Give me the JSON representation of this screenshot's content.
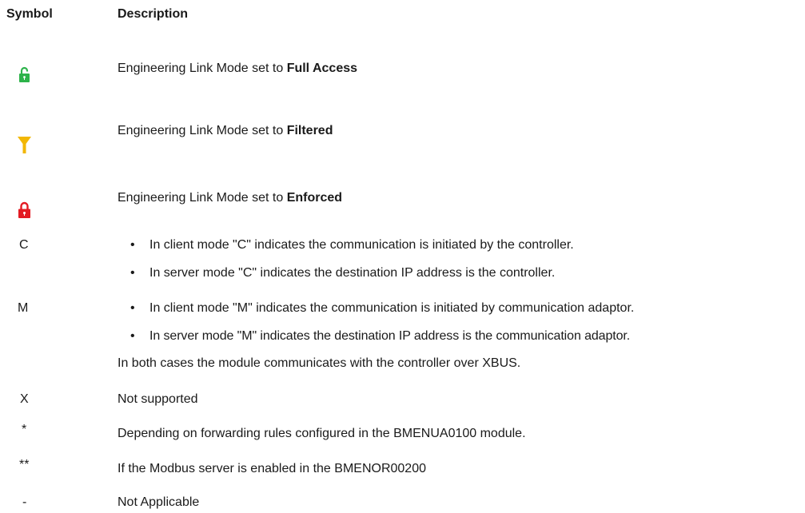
{
  "header": {
    "symbol": "Symbol",
    "description": "Description"
  },
  "rows": {
    "full_access": {
      "icon": "unlocked-padlock-icon",
      "color": "#2db34a",
      "text_prefix": "Engineering Link Mode set to ",
      "text_bold": "Full Access"
    },
    "filtered": {
      "icon": "funnel-filter-icon",
      "color": "#f2b705",
      "text_prefix": "Engineering Link Mode set to ",
      "text_bold": "Filtered"
    },
    "enforced": {
      "icon": "locked-padlock-icon",
      "color": "#e31b23",
      "text_prefix": "Engineering Link Mode set to ",
      "text_bold": "Enforced"
    },
    "c": {
      "symbol": "C",
      "bullet": "•",
      "items": [
        "In client mode \"C\" indicates the communication is initiated by the controller.",
        "In server mode \"C\" indicates the destination IP address is the controller."
      ]
    },
    "m": {
      "symbol": "M",
      "bullet": "•",
      "items": [
        "In client mode \"M\" indicates the communication is initiated by communication adaptor.",
        "In server mode \"M\" indicates the destination IP address is the communication adaptor."
      ],
      "note": "In both cases the module communicates with the controller over XBUS."
    },
    "x": {
      "symbol": "X",
      "text": "Not supported"
    },
    "star": {
      "symbol": "*",
      "text": "Depending on forwarding rules configured in the BMENUA0100 module."
    },
    "double_star": {
      "symbol": "**",
      "text": "If the Modbus server is enabled in the BMENOR00200"
    },
    "dash": {
      "symbol": "-",
      "text": "Not Applicable"
    }
  }
}
